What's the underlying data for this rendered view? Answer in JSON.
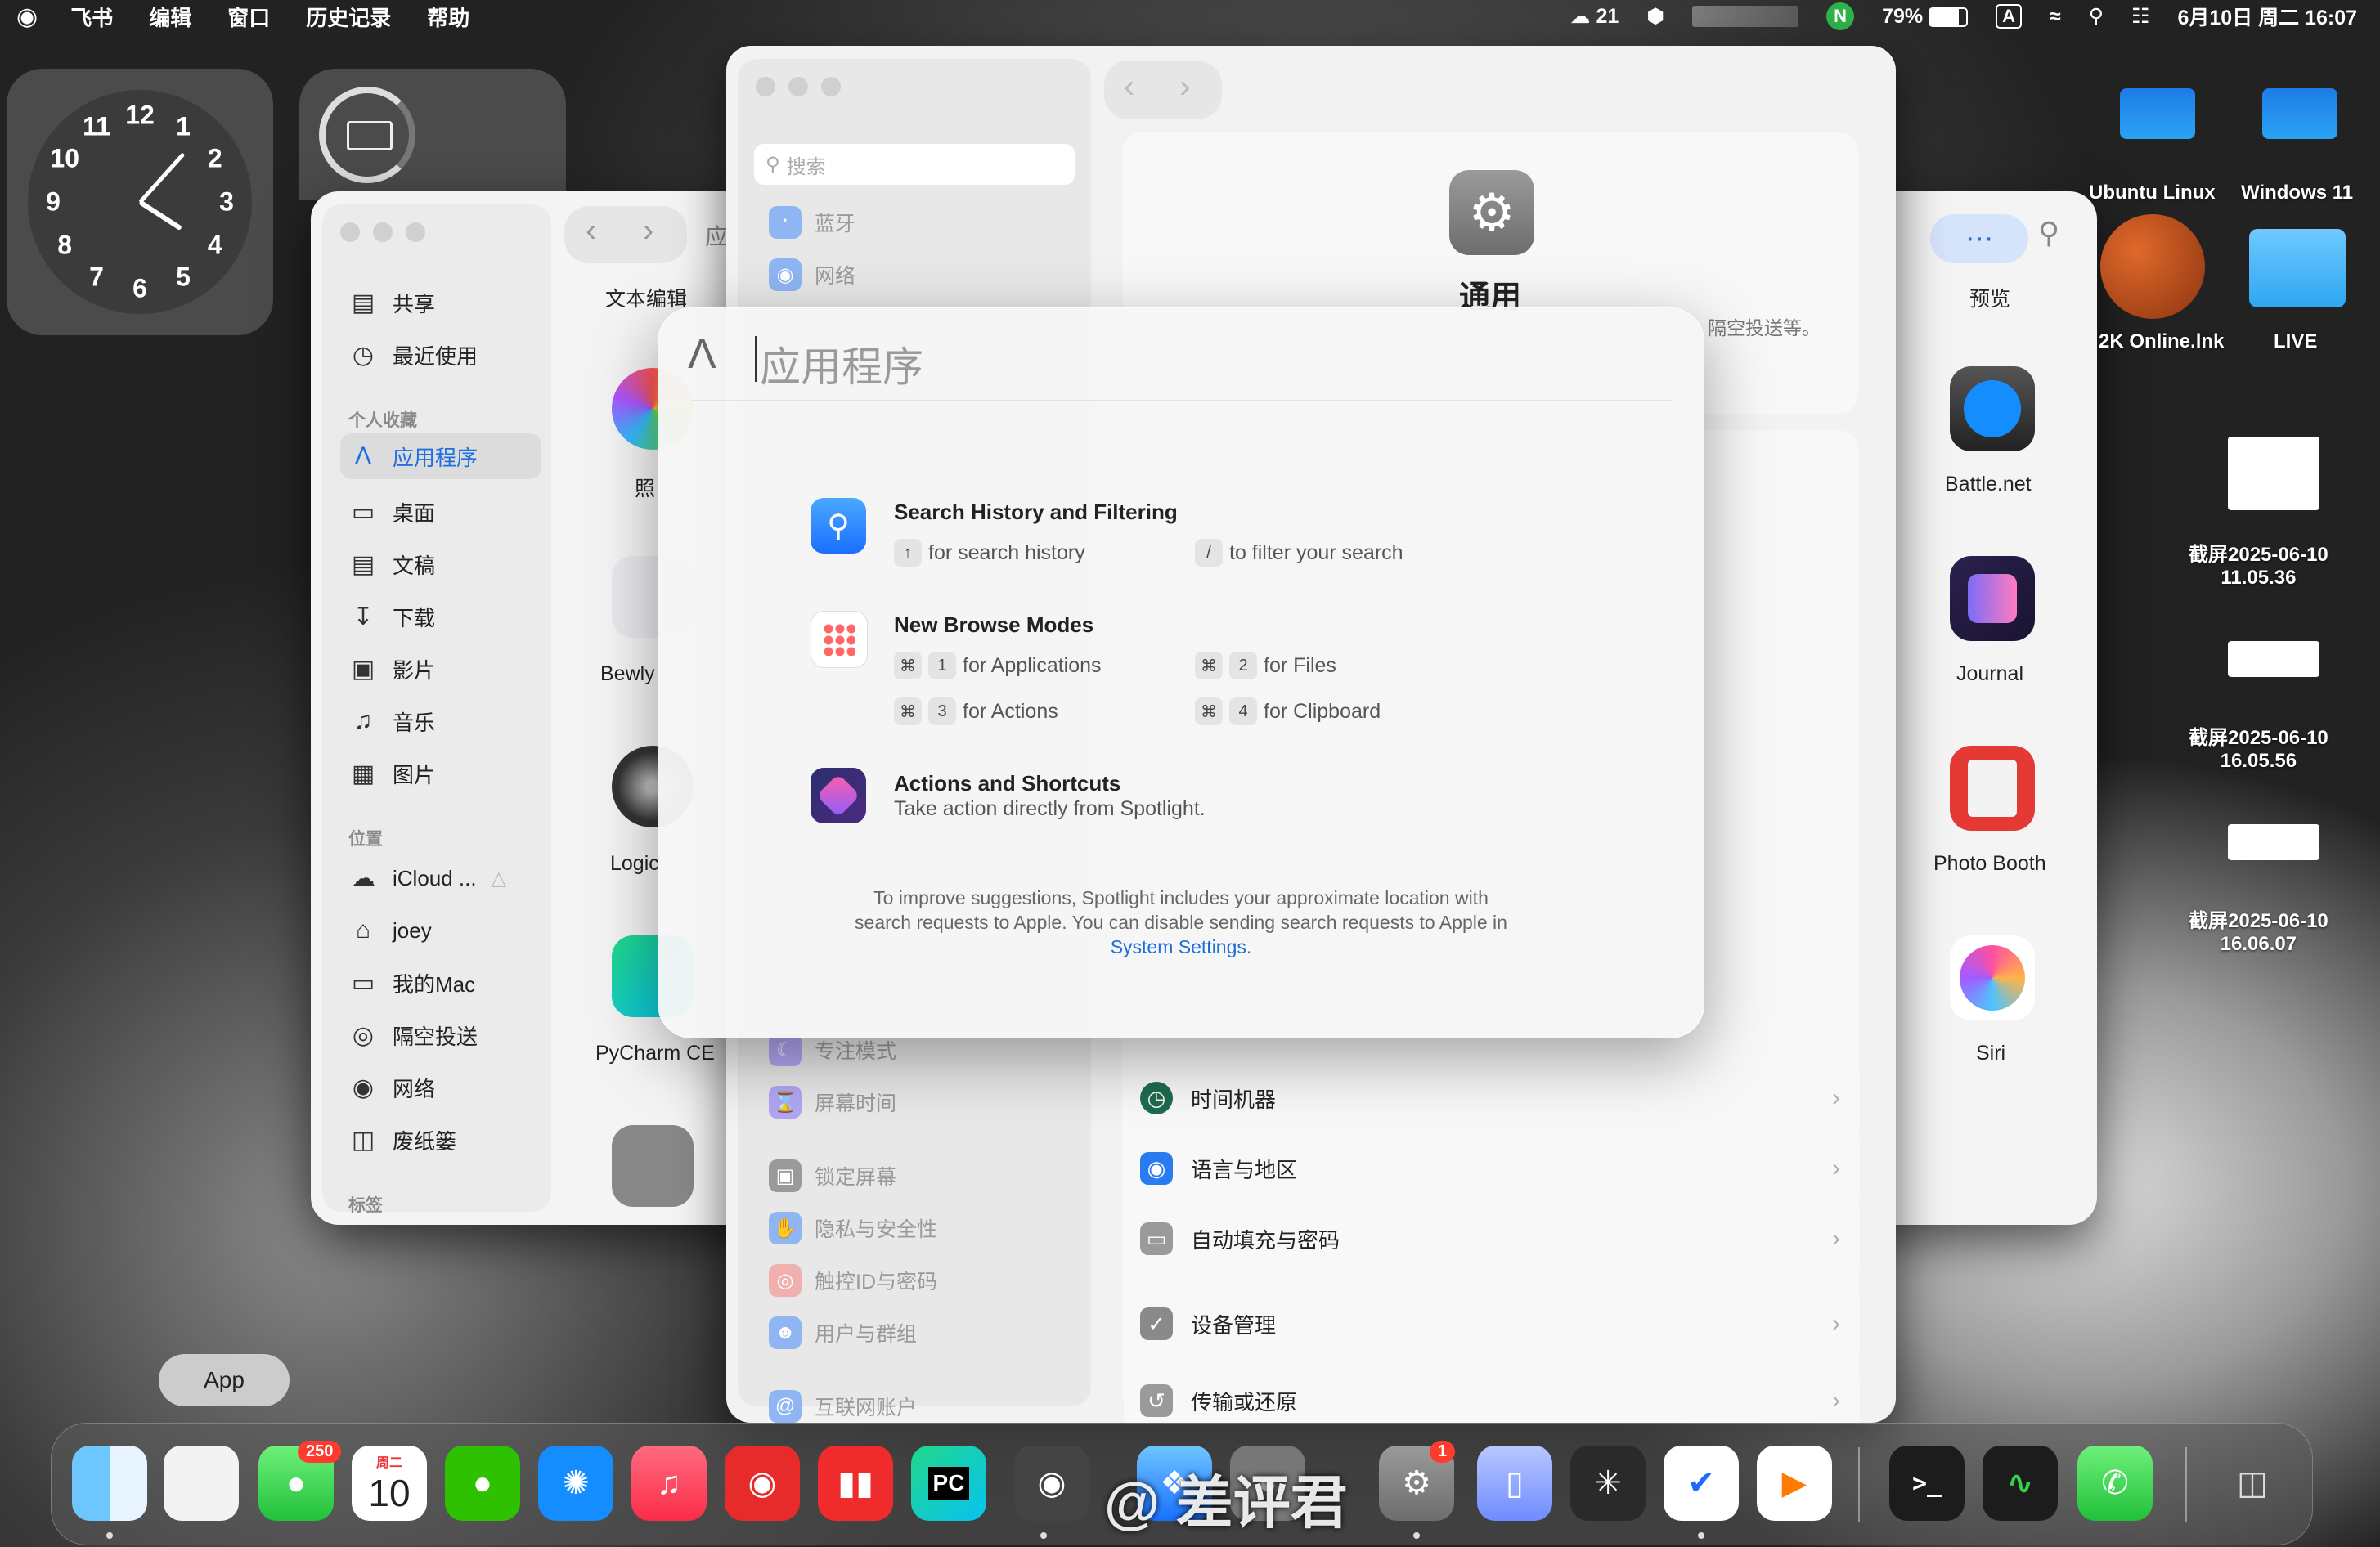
{
  "menubar": {
    "apple": "",
    "items": [
      "飞书",
      "编辑",
      "窗口",
      "历史记录",
      "帮助"
    ],
    "status": {
      "weather": "21",
      "battery": "79%",
      "input": "A",
      "datetime": "6月10日 周二 16:07"
    }
  },
  "finder": {
    "nav_title": "应",
    "favorites_header": "个人收藏",
    "location_header": "位置",
    "tags_header": "标签",
    "items_top": [
      {
        "label": "共享",
        "icon": "shared-icon"
      },
      {
        "label": "最近使用",
        "icon": "clock-icon"
      }
    ],
    "favorites": [
      {
        "label": "应用程序",
        "icon": "applications-icon"
      },
      {
        "label": "桌面",
        "icon": "desktop-icon"
      },
      {
        "label": "文稿",
        "icon": "document-icon"
      },
      {
        "label": "下载",
        "icon": "download-icon"
      },
      {
        "label": "影片",
        "icon": "film-icon"
      },
      {
        "label": "音乐",
        "icon": "music-icon"
      },
      {
        "label": "图片",
        "icon": "photo-icon"
      }
    ],
    "locations": [
      {
        "label": "iCloud ...",
        "icon": "cloud-icon"
      },
      {
        "label": "joey",
        "icon": "home-icon"
      },
      {
        "label": "我的Mac",
        "icon": "folder-icon"
      },
      {
        "label": "隔空投送",
        "icon": "airdrop-icon"
      },
      {
        "label": "网络",
        "icon": "globe-icon"
      },
      {
        "label": "废纸篓",
        "icon": "trash-icon"
      }
    ],
    "apps_left": [
      "文本编辑",
      "照",
      "Bewly",
      "Logic",
      "PyCharm CE"
    ],
    "apps_right": [
      "预览",
      "Battle.net",
      "Journal",
      "Photo Booth",
      "Siri"
    ]
  },
  "settings": {
    "search_placeholder": "搜索",
    "sidebar_top": [
      {
        "label": "蓝牙",
        "icon": "bluetooth-icon"
      },
      {
        "label": "网络",
        "icon": "network-icon"
      }
    ],
    "sidebar_bottom": [
      {
        "label": "专注模式",
        "icon": "moon-icon"
      },
      {
        "label": "屏幕时间",
        "icon": "hourglass-icon"
      },
      {
        "label": "锁定屏幕",
        "icon": "lock-icon"
      },
      {
        "label": "隐私与安全性",
        "icon": "hand-icon"
      },
      {
        "label": "触控ID与密码",
        "icon": "fingerprint-icon"
      },
      {
        "label": "用户与群组",
        "icon": "users-icon"
      },
      {
        "label": "互联网账户",
        "icon": "at-icon"
      }
    ],
    "header_title": "通用",
    "header_desc_tail": "隔空投送等。",
    "rows": [
      {
        "label": "时间机器",
        "icon": "time-machine-icon"
      },
      {
        "label": "语言与地区",
        "icon": "globe-icon"
      },
      {
        "label": "自动填充与密码",
        "icon": "key-icon"
      },
      {
        "label": "设备管理",
        "icon": "check-shield-icon"
      },
      {
        "label": "传输或还原",
        "icon": "restore-icon"
      }
    ]
  },
  "spotlight": {
    "query": "应用程序",
    "tips": [
      {
        "title": "Search History and Filtering",
        "lines": [
          {
            "key": "↑",
            "text": "for search history"
          },
          {
            "key": "/",
            "text": "to filter your search"
          }
        ]
      },
      {
        "title": "New Browse Modes",
        "lines": [
          {
            "key": "1",
            "text": "for Applications"
          },
          {
            "key": "2",
            "text": "for Files"
          },
          {
            "key": "3",
            "text": "for Actions"
          },
          {
            "key": "4",
            "text": "for Clipboard"
          }
        ]
      },
      {
        "title": "Actions and Shortcuts",
        "subtitle": "Take action directly from Spotlight."
      }
    ],
    "cmd_symbol": "⌘",
    "footer_line1": "To improve suggestions, Spotlight includes your approximate location with",
    "footer_line2": "search requests to Apple. You can disable sending search requests to Apple in",
    "footer_link": "System Settings",
    "footer_end": "."
  },
  "desktop": {
    "icons": [
      {
        "label": "Ubuntu Linux"
      },
      {
        "label": "Windows 11"
      },
      {
        "label": "2K Online.lnk"
      },
      {
        "label": "LIVE"
      },
      {
        "label": "截屏2025-06-10\n11.05.36"
      },
      {
        "label": "截屏2025-06-10\n16.05.56"
      },
      {
        "label": "截屏2025-06-10\n16.06.07"
      }
    ],
    "clock_numbers": [
      "12",
      "1",
      "2",
      "3",
      "4",
      "5",
      "6",
      "7",
      "8",
      "9",
      "10",
      "11"
    ]
  },
  "dock": {
    "tooltip": "App",
    "messages_badge": "250",
    "calendar_day": "周二",
    "calendar_date": "10",
    "settings_badge": "1",
    "pycharm_text": "PC",
    "watermark": "@ 差评君",
    "terminal_text": ">_"
  }
}
